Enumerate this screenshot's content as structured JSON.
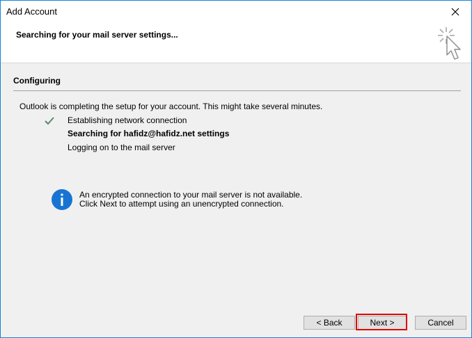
{
  "window": {
    "title": "Add Account",
    "close_icon": "close-icon",
    "border_color": "#1883d7"
  },
  "header": {
    "title": "Searching for your mail server settings...",
    "icon": "cursor-click-icon"
  },
  "section": {
    "title": "Configuring",
    "intro": "Outlook is completing the setup for your account. This might take several minutes."
  },
  "steps": [
    {
      "label": "Establishing network connection",
      "status": "complete",
      "icon": "checkmark-icon"
    },
    {
      "label": "Searching for hafidz@hafidz.net settings",
      "status": "in-progress"
    },
    {
      "label": "Logging on to the mail server",
      "status": "pending"
    }
  ],
  "notice": {
    "icon": "info-icon",
    "line1": "An encrypted connection to your mail server is not available.",
    "line2": "Click Next to attempt using an unencrypted connection."
  },
  "buttons": {
    "back": "< Back",
    "next": "Next >",
    "cancel": "Cancel"
  },
  "colors": {
    "highlight": "#e00000",
    "info_blue": "#1874d2",
    "check_green": "#5a8a6a"
  }
}
